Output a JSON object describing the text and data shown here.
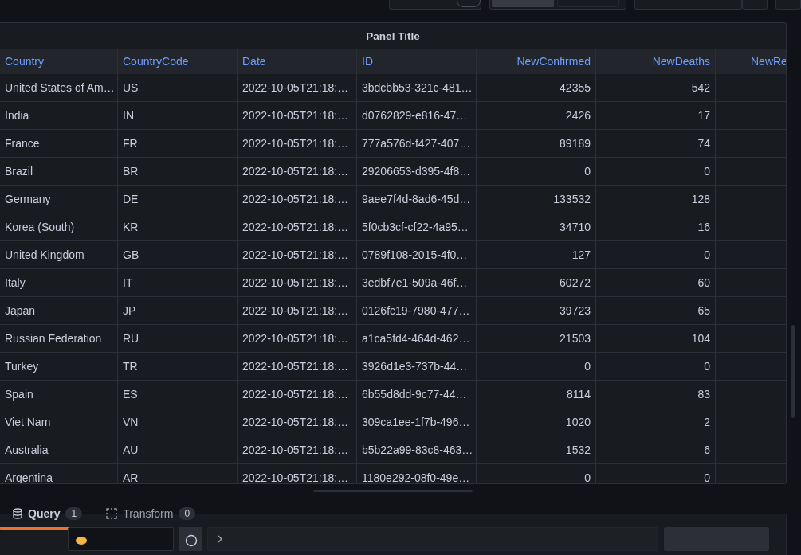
{
  "toolbar": {
    "table_view_toggle": {
      "on": false
    },
    "view_options": [
      {
        "selected": true
      },
      {
        "selected": false
      }
    ]
  },
  "panel": {
    "title": "Panel Title",
    "table": {
      "columns": [
        {
          "label": "Country",
          "kind": "text"
        },
        {
          "label": "CountryCode",
          "kind": "text"
        },
        {
          "label": "Date",
          "kind": "text"
        },
        {
          "label": "ID",
          "kind": "text"
        },
        {
          "label": "NewConfirmed",
          "kind": "number"
        },
        {
          "label": "NewDeaths",
          "kind": "number"
        },
        {
          "label": "NewRe",
          "kind": "number"
        }
      ],
      "rows": [
        [
          "United States of Am…",
          "US",
          "2022-10-05T21:18:…",
          "3bdcbb53-321c-481…",
          "42355",
          "542"
        ],
        [
          "India",
          "IN",
          "2022-10-05T21:18:…",
          "d0762829-e816-47…",
          "2426",
          "17"
        ],
        [
          "France",
          "FR",
          "2022-10-05T21:18:…",
          "777a576d-f427-407…",
          "89189",
          "74"
        ],
        [
          "Brazil",
          "BR",
          "2022-10-05T21:18:…",
          "29206653-d395-4f8…",
          "0",
          "0"
        ],
        [
          "Germany",
          "DE",
          "2022-10-05T21:18:…",
          "9aee7f4d-8ad6-45d…",
          "133532",
          "128"
        ],
        [
          "Korea (South)",
          "KR",
          "2022-10-05T21:18:…",
          "5f0cb3cf-cf22-4a95…",
          "34710",
          "16"
        ],
        [
          "United Kingdom",
          "GB",
          "2022-10-05T21:18:…",
          "0789f108-2015-4f0…",
          "127",
          "0"
        ],
        [
          "Italy",
          "IT",
          "2022-10-05T21:18:…",
          "3edbf7e1-509a-46f…",
          "60272",
          "60"
        ],
        [
          "Japan",
          "JP",
          "2022-10-05T21:18:…",
          "0126fc19-7980-477…",
          "39723",
          "65"
        ],
        [
          "Russian Federation",
          "RU",
          "2022-10-05T21:18:…",
          "a1ca5fd4-464d-462…",
          "21503",
          "104"
        ],
        [
          "Turkey",
          "TR",
          "2022-10-05T21:18:…",
          "3926d1e3-737b-44…",
          "0",
          "0"
        ],
        [
          "Spain",
          "ES",
          "2022-10-05T21:18:…",
          "6b55d8dd-9c77-44…",
          "8114",
          "83"
        ],
        [
          "Viet Nam",
          "VN",
          "2022-10-05T21:18:…",
          "309ca1ee-1f7b-496…",
          "1020",
          "2"
        ],
        [
          "Australia",
          "AU",
          "2022-10-05T21:18:…",
          "b5b22a99-83c8-463…",
          "1532",
          "6"
        ],
        [
          "Argentina",
          "AR",
          "2022-10-05T21:18:…",
          "1180e292-08f0-49e…",
          "0",
          "0"
        ]
      ]
    }
  },
  "query_tabs": [
    {
      "label": "Query",
      "count": "1",
      "kind": "query",
      "selected": true
    },
    {
      "label": "Transform",
      "count": "0",
      "kind": "transform",
      "selected": false
    }
  ]
}
